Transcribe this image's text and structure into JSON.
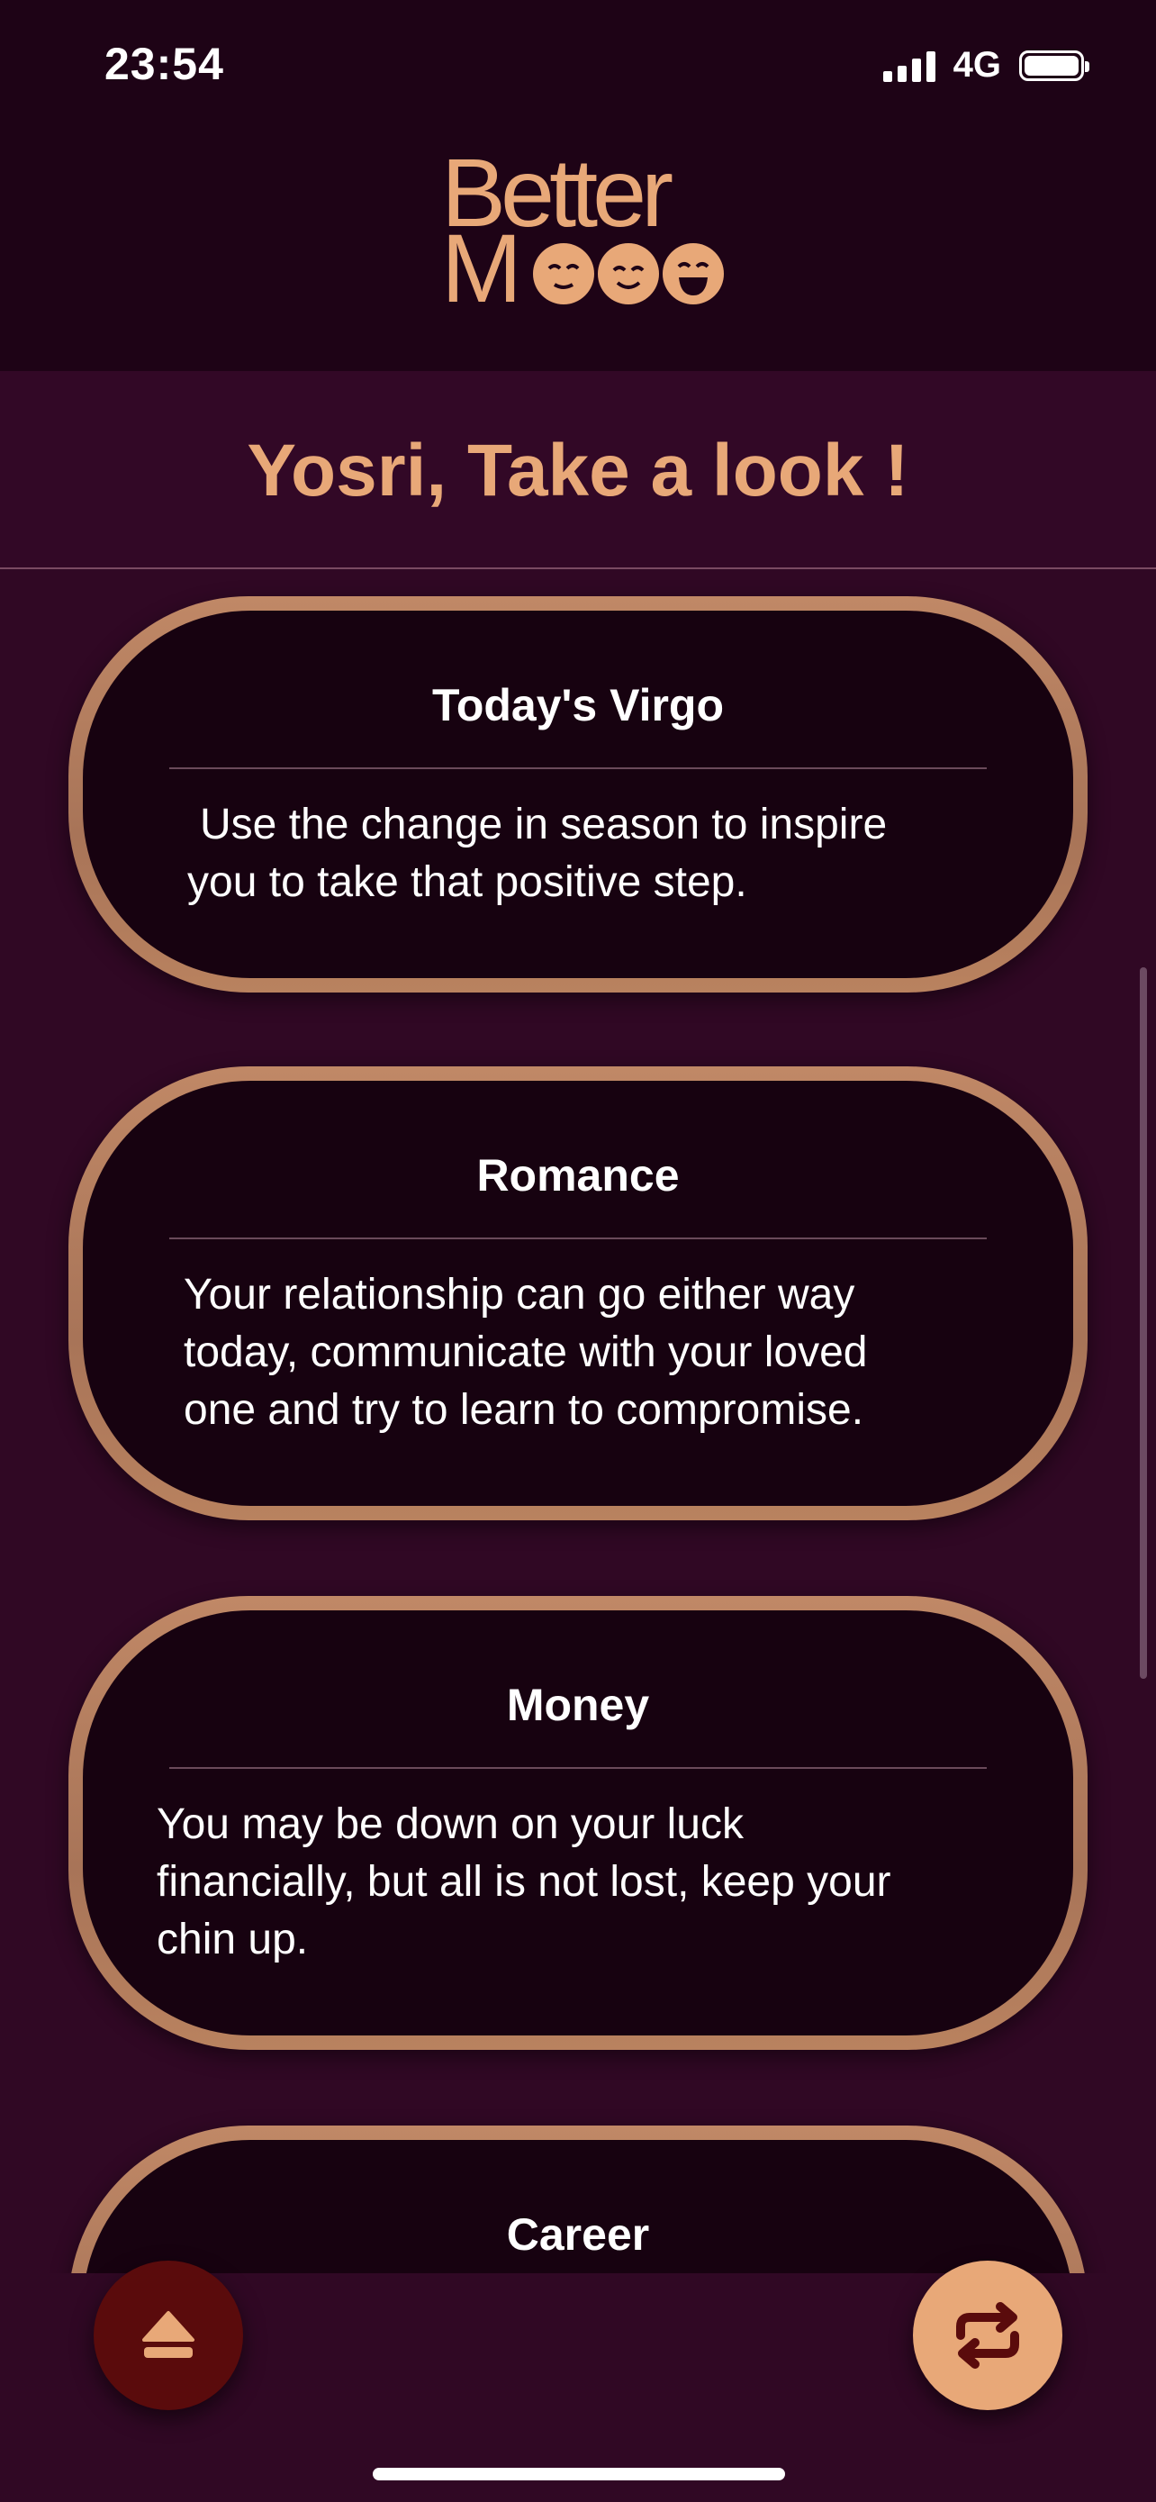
{
  "status_bar": {
    "time": "23:54",
    "network": "4G"
  },
  "header": {
    "logo_line1": "Better",
    "logo_line2": "M"
  },
  "page": {
    "title": "Yosri, Take a look !"
  },
  "cards": [
    {
      "title": "Today's Virgo",
      "body_lines": [
        "Use the change in season to inspire",
        "you to take that positive step."
      ]
    },
    {
      "title": "Romance",
      "body_lines": [
        "Your relationship can go either way",
        "today, communicate with your loved",
        "one and try to learn to compromise."
      ]
    },
    {
      "title": "Money",
      "body_lines": [
        "You may be down on your luck",
        "financially, but all is not lost, keep your",
        "chin up."
      ]
    },
    {
      "title": "Career",
      "body_lines": []
    }
  ],
  "actions": {
    "left_icon": "eject-icon",
    "right_icon": "repeat-icon"
  },
  "colors": {
    "accent": "#e8a878",
    "background": "#300824",
    "card": "#170210",
    "left_button": "#5a0b0c"
  }
}
